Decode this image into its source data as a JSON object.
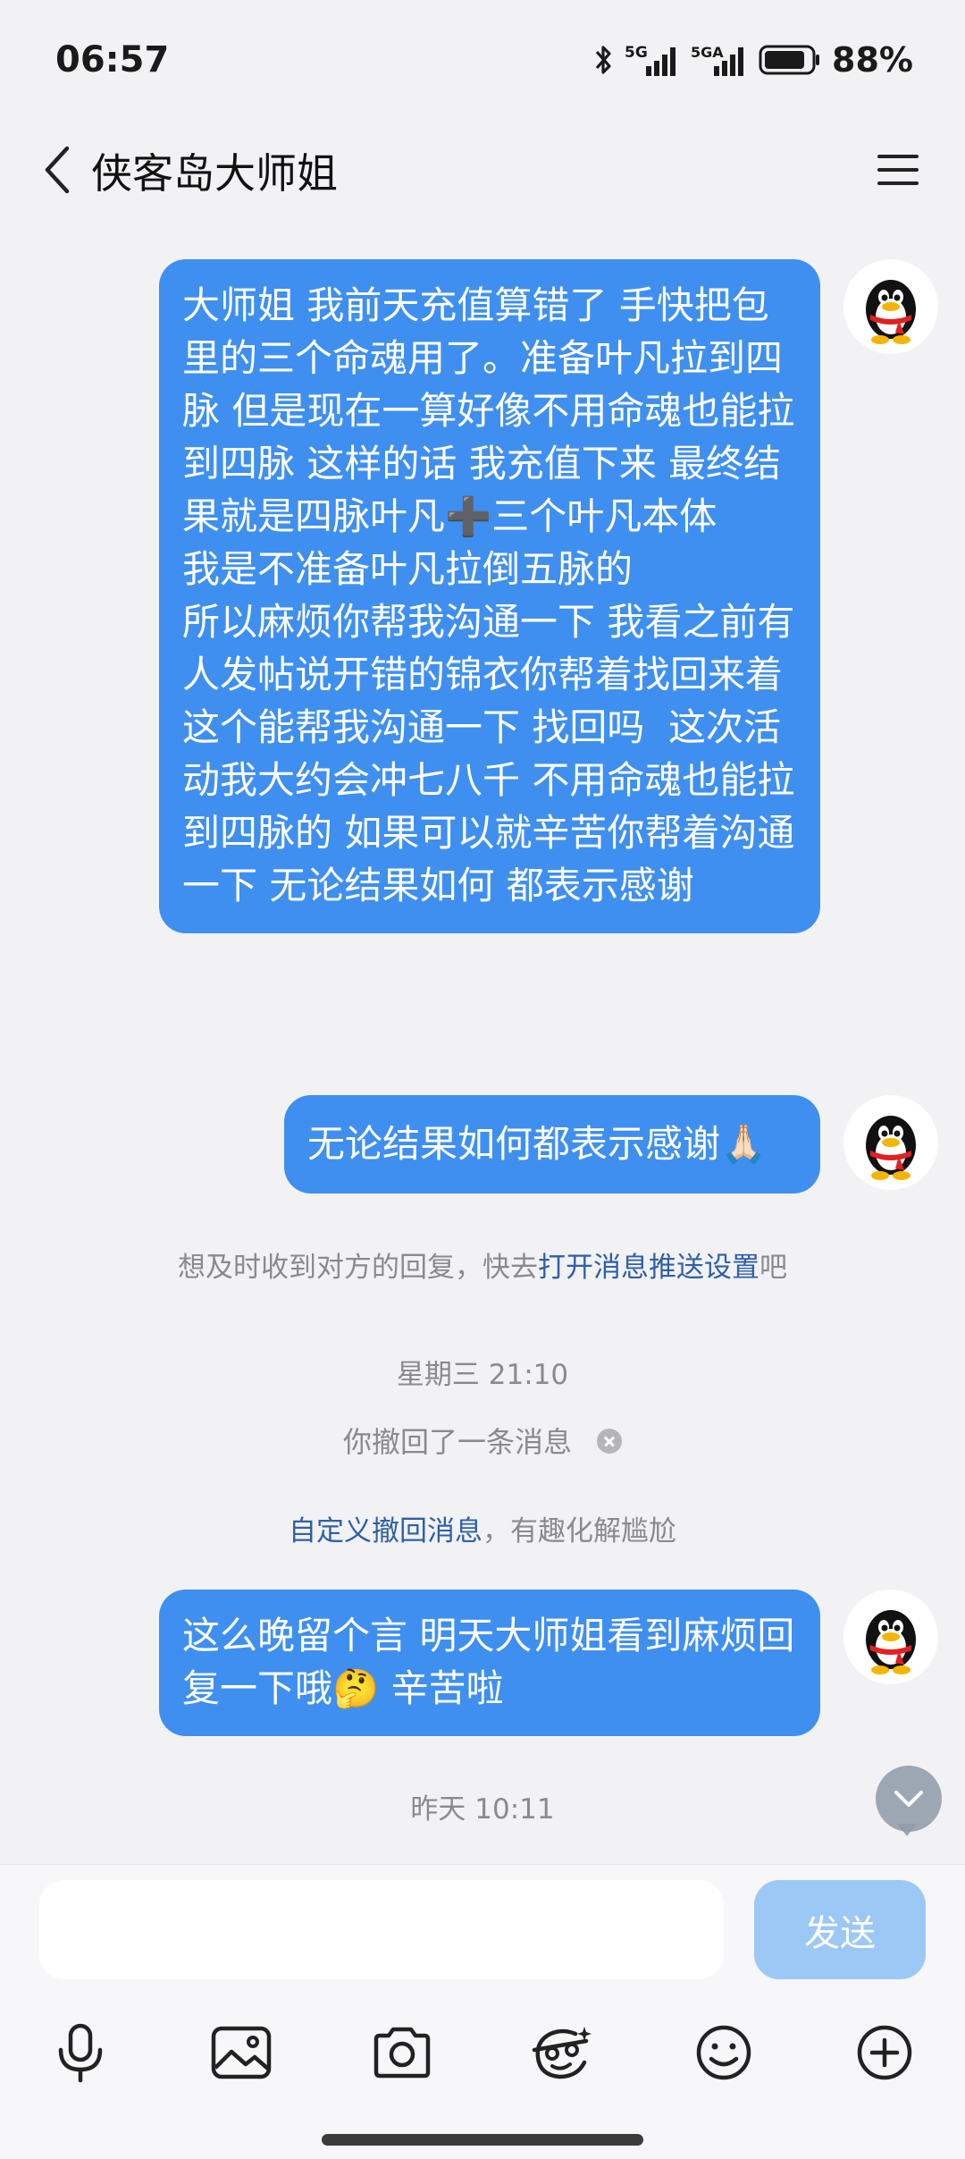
{
  "status_bar": {
    "time": "06:57",
    "battery_percent": "88%",
    "battery_level": 0.88,
    "network_1": "5G",
    "network_2": "5GA"
  },
  "chat": {
    "title": "侠客岛大师姐"
  },
  "messages": [
    {
      "type": "outgoing",
      "text": "大师姐 我前天充值算错了 手快把包里的三个命魂用了。准备叶凡拉到四脉 但是现在一算好像不用命魂也能拉到四脉 这样的话 我充值下来 最终结果就是四脉叶凡➕三个叶凡本体\n我是不准备叶凡拉倒五脉的\n所以麻烦你帮我沟通一下 我看之前有人发帖说开错的锦衣你帮着找回来着 这个能帮我沟通一下 找回吗  这次活动我大约会冲七八千 不用命魂也能拉到四脉的 如果可以就辛苦你帮着沟通一下 无论结果如何 都表示感谢"
    },
    {
      "type": "outgoing",
      "text": "无论结果如何都表示感谢🙏🏻"
    },
    {
      "type": "outgoing",
      "text": "这么晚留个言 明天大师姐看到麻烦回复一下哦🤔 辛苦啦"
    }
  ],
  "system": {
    "push_tip_prefix": "想及时收到对方的回复，快去",
    "push_tip_link": "打开消息推送设置",
    "push_tip_suffix": "吧",
    "time_wed": "星期三 21:10",
    "recalled": "你撤回了一条消息",
    "custom_recall_link": "自定义撤回消息",
    "custom_recall_suffix": "，有趣化解尴尬",
    "time_yesterday": "昨天 10:11"
  },
  "input": {
    "placeholder": "",
    "send_label": "发送"
  },
  "toolbar": {
    "icons": [
      "microphone-icon",
      "image-icon",
      "camera-icon",
      "sticker-icon",
      "emoji-icon",
      "plus-icon"
    ]
  }
}
